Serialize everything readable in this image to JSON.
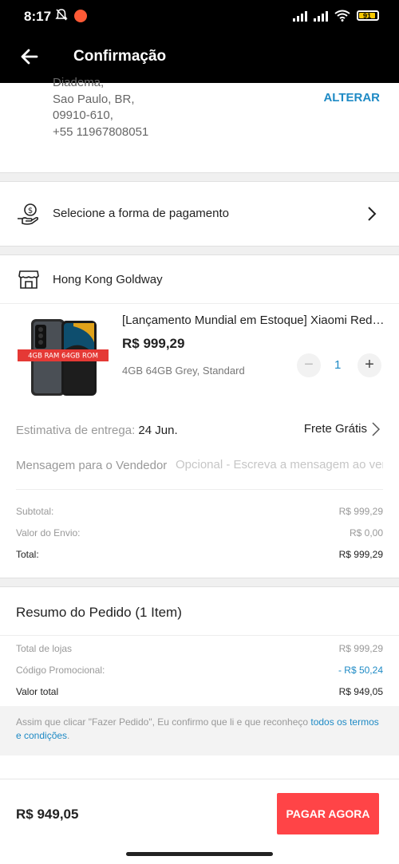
{
  "status_bar": {
    "time": "8:17",
    "battery": "91"
  },
  "app_bar": {
    "title": "Confirmação"
  },
  "address": {
    "lines": [
      "Diadema,",
      "Sao Paulo, BR,",
      "09910-610,",
      "+55 11967808051"
    ],
    "change_label": "ALTERAR"
  },
  "payment": {
    "label": "Selecione a forma de pagamento"
  },
  "store": {
    "name": "Hong Kong Goldway"
  },
  "product": {
    "title": "[Lançamento Mundial em Estoque] Xiaomi Redmi...",
    "price": "R$ 999,29",
    "variant": "4GB 64GB Grey, Standard",
    "image_badge": "4GB RAM 64GB ROM",
    "quantity": "1"
  },
  "delivery": {
    "label": "Estimativa de entrega:",
    "date": "24 Jun.",
    "shipping": "Frete Grátis"
  },
  "message": {
    "label": "Mensagem para o Vendedor",
    "placeholder": "Opcional - Escreva a mensagem ao vendedor"
  },
  "order_summary": {
    "subtotal_label": "Subtotal:",
    "subtotal_value": "R$ 999,29",
    "shipping_label": "Valor do Envio:",
    "shipping_value": "R$ 0,00",
    "total_label": "Total:",
    "total_value": "R$ 999,29"
  },
  "resumo": {
    "title": "Resumo do Pedido (1 Item)",
    "stores_label": "Total de lojas",
    "stores_value": "R$ 999,29",
    "promo_label": "Código Promocional:",
    "promo_value": "- R$ 50,24",
    "total_label": "Valor total",
    "total_value": "R$ 949,05"
  },
  "terms": {
    "text": "Assim que clicar \"Fazer Pedido\", Eu confirmo que li e que reconheço ",
    "link": "todos os termos e condições",
    "end": "."
  },
  "bottom_bar": {
    "total": "R$ 949,05",
    "pay_button": "PAGAR AGORA"
  },
  "colors": {
    "accent": "#1e8ac5",
    "pay_button": "#ff4447",
    "header": "#000000"
  }
}
